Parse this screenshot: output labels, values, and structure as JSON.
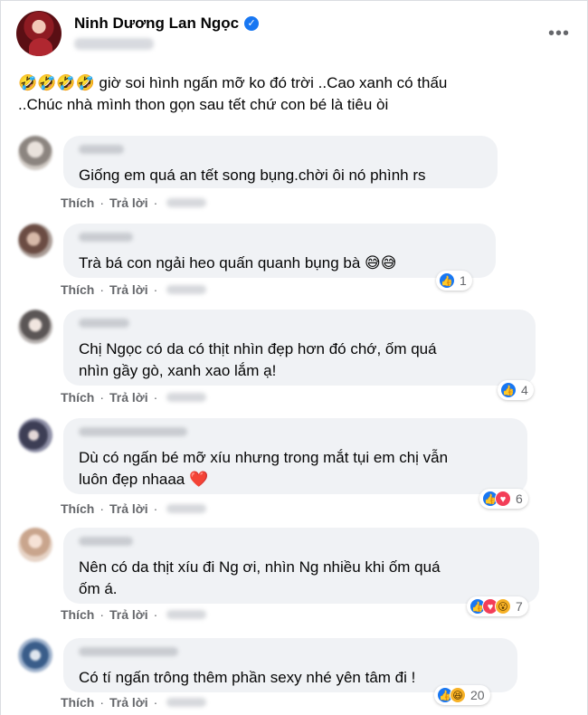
{
  "post": {
    "author": "Ninh Dương Lan Ngọc",
    "text_line1": "🤣🤣🤣🤣 giờ soi hình ngấn mỡ ko đó trời ..Cao xanh có thấu",
    "text_line2": "..Chúc nhà mình thon gọn sau tết chứ con bé là tiêu òi"
  },
  "labels": {
    "like": "Thích",
    "reply": "Trả lời",
    "dot": "·"
  },
  "comments": [
    {
      "text": "Giống em quá an tết song bụng.chời ôi nó phình rs",
      "reaction_count": ""
    },
    {
      "text": "Trà bá con ngải heo quấn quanh bụng bà 😅😅",
      "reaction_count": "1"
    },
    {
      "text": "Chị Ngọc có da có thịt nhìn đẹp hơn đó chớ, ốm quá\nnhìn gầy gò, xanh xao lắm ạ!",
      "reaction_count": "4"
    },
    {
      "text": "Dù có ngấn bé mỡ xíu nhưng trong mắt tụi em chị vẫn\nluôn đẹp nhaaa ❤️",
      "reaction_count": "6"
    },
    {
      "text": "Nên có da thịt xíu đi Ng ơi, nhìn Ng nhiều khi ốm quá\nốm á.",
      "reaction_count": "7"
    },
    {
      "text": "Có tí ngấn trông thêm phần sexy nhé yên tâm đi !",
      "reaction_count": "20"
    }
  ],
  "colors": {
    "bubble": "#f0f2f5",
    "like_blue": "#1877f2",
    "love_red": "#f33e58",
    "muted": "#65676b"
  }
}
